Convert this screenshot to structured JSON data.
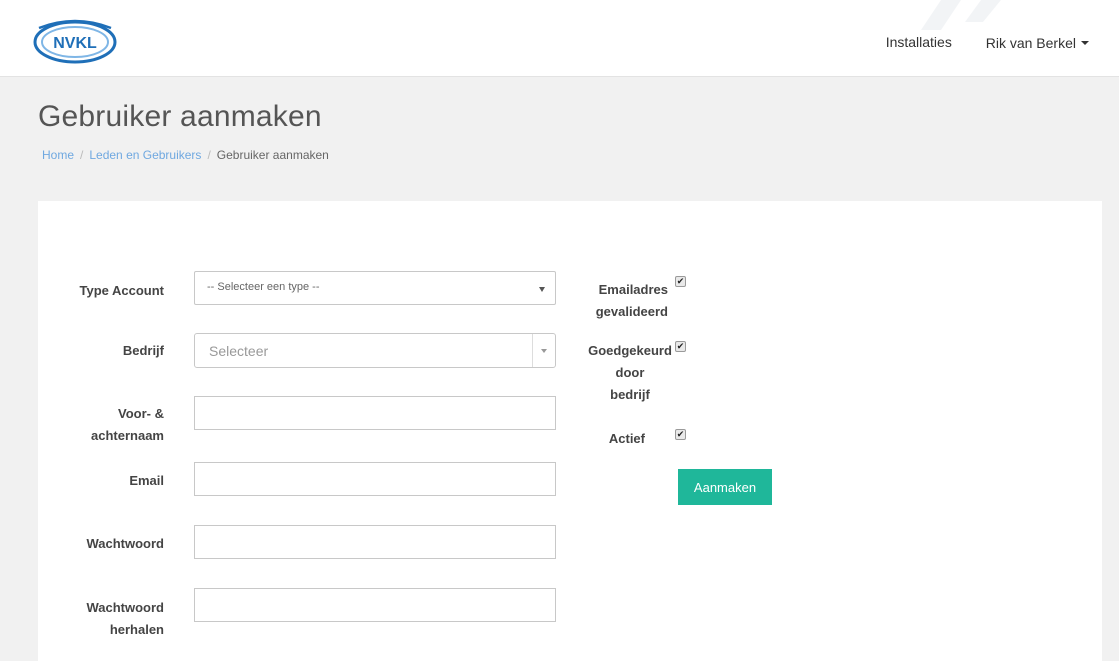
{
  "logo": {
    "text": "NVKL"
  },
  "nav": {
    "installaties": "Installaties",
    "user": "Rik van Berkel"
  },
  "page": {
    "title": "Gebruiker aanmaken"
  },
  "breadcrumb": {
    "home": "Home",
    "leden": "Leden en Gebruikers",
    "current": "Gebruiker aanmaken",
    "separator": "/"
  },
  "form": {
    "type_account": {
      "label": "Type Account",
      "value": "-- Selecteer een type --"
    },
    "bedrijf": {
      "label": "Bedrijf",
      "placeholder": "Selecteer"
    },
    "naam": {
      "label_line1": "Voor- &",
      "label_line2": "achternaam",
      "value": ""
    },
    "email": {
      "label": "Email",
      "value": ""
    },
    "wachtwoord": {
      "label": "Wachtwoord",
      "value": ""
    },
    "wachtwoord_herhalen": {
      "label_line1": "Wachtwoord",
      "label_line2": "herhalen",
      "value": ""
    },
    "emailadres_gevalideerd": {
      "label_line1": "Emailadres",
      "label_line2": "gevalideerd",
      "checked": true
    },
    "goedgekeurd": {
      "label_line1": "Goedgekeurd",
      "label_line2": "door",
      "label_line3": "bedrijf",
      "checked": true
    },
    "actief": {
      "label": "Actief",
      "checked": true
    },
    "check_glyph": "✔",
    "submit": "Aanmaken"
  },
  "colors": {
    "accent": "#1fb79a",
    "link": "#6fa8e0",
    "background": "#f1f1f1"
  }
}
